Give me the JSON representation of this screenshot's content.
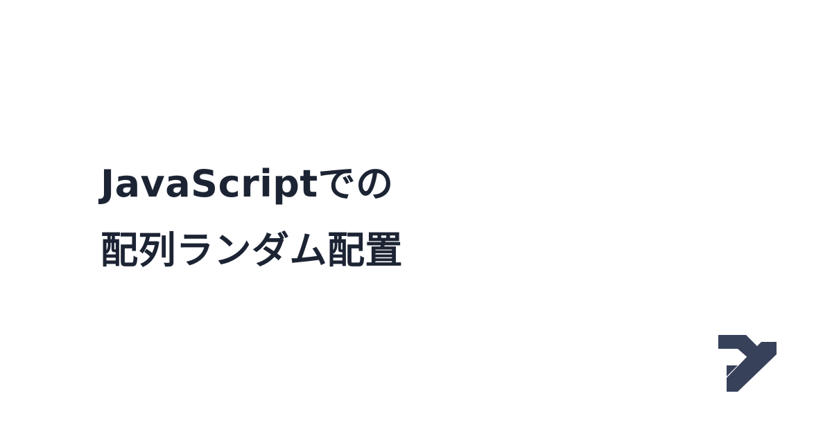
{
  "title": {
    "line1": "JavaScriptでの",
    "line2": "配列ランダム配置"
  },
  "brand": {
    "logo_icon": "y-monogram-icon",
    "logo_color": "#37415a",
    "text_color": "#1c2434",
    "background": "#ffffff"
  }
}
